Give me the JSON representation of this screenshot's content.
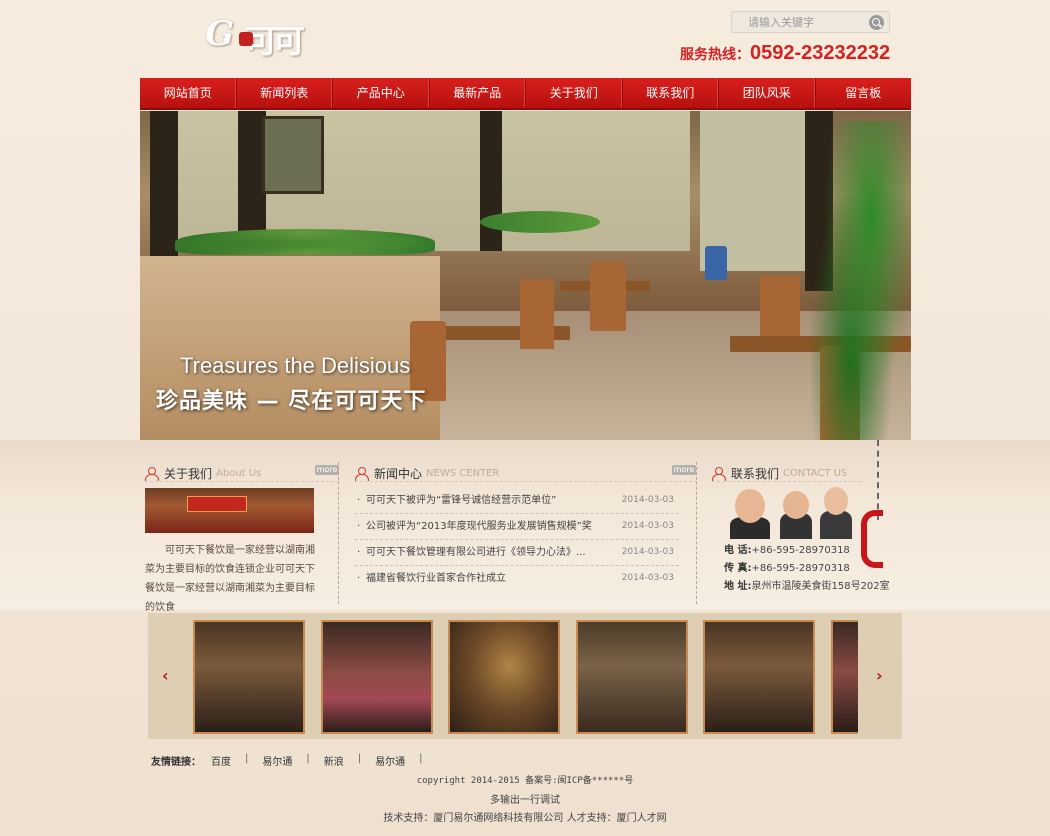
{
  "header": {
    "search_placeholder": "请输入关键字",
    "hotline_label": "服务热线：",
    "hotline_number": "0592-23232232",
    "logo_letter": "G",
    "logo_cn": "可可"
  },
  "nav": {
    "items": [
      "网站首页",
      "新闻列表",
      "产品中心",
      "最新产品",
      "关于我们",
      "联系我们",
      "团队风采",
      "留言板"
    ]
  },
  "banner": {
    "title_en": "Treasures the Delisious",
    "title_cn": "珍品美味 — 尽在可可天下"
  },
  "about": {
    "title": "关于我们",
    "title_en": "About Us",
    "more": "more",
    "text": "可可天下餐饮是一家经营以湖南湘菜为主要目标的饮食连锁企业可可天下餐饮是一家经营以湖南湘菜为主要目标的饮食"
  },
  "news": {
    "title": "新闻中心",
    "title_en": "NEWS CENTER",
    "more": "more",
    "items": [
      {
        "title": "可可天下被评为“雷锋号诚信经营示范单位”",
        "date": "2014-03-03"
      },
      {
        "title": "公司被评为“2013年度现代服务业发展销售规模”奖",
        "date": "2014-03-03"
      },
      {
        "title": "可可天下餐饮管理有限公司进行《领导力心法》...",
        "date": "2014-03-03"
      },
      {
        "title": "福建省餐饮行业首家合作社成立",
        "date": "2014-03-03"
      }
    ]
  },
  "contact": {
    "title": "联系我们",
    "title_en": "CONTACT US",
    "tel_label": "电  话:",
    "tel": "+86-595-28970318",
    "fax_label": "传  真:",
    "fax": "+86-595-28970318",
    "addr_label": "地  址:",
    "addr": "泉州市温陵美食街158号202室"
  },
  "gallery": {
    "prev": "‹",
    "next": "›"
  },
  "footer": {
    "links_label": "友情链接：",
    "links": [
      "百度",
      "易尔通",
      "新浪",
      "易尔通"
    ],
    "separator": "|",
    "copyright": "copyright 2014-2015 备案号:闽ICP备******号",
    "debug": "多输出一行调试",
    "tech": "技术支持：厦门易尔通网络科技有限公司 人才支持：厦门人才网"
  },
  "colors": {
    "brand_red": "#c4181a",
    "background": "#f4e9dc"
  }
}
